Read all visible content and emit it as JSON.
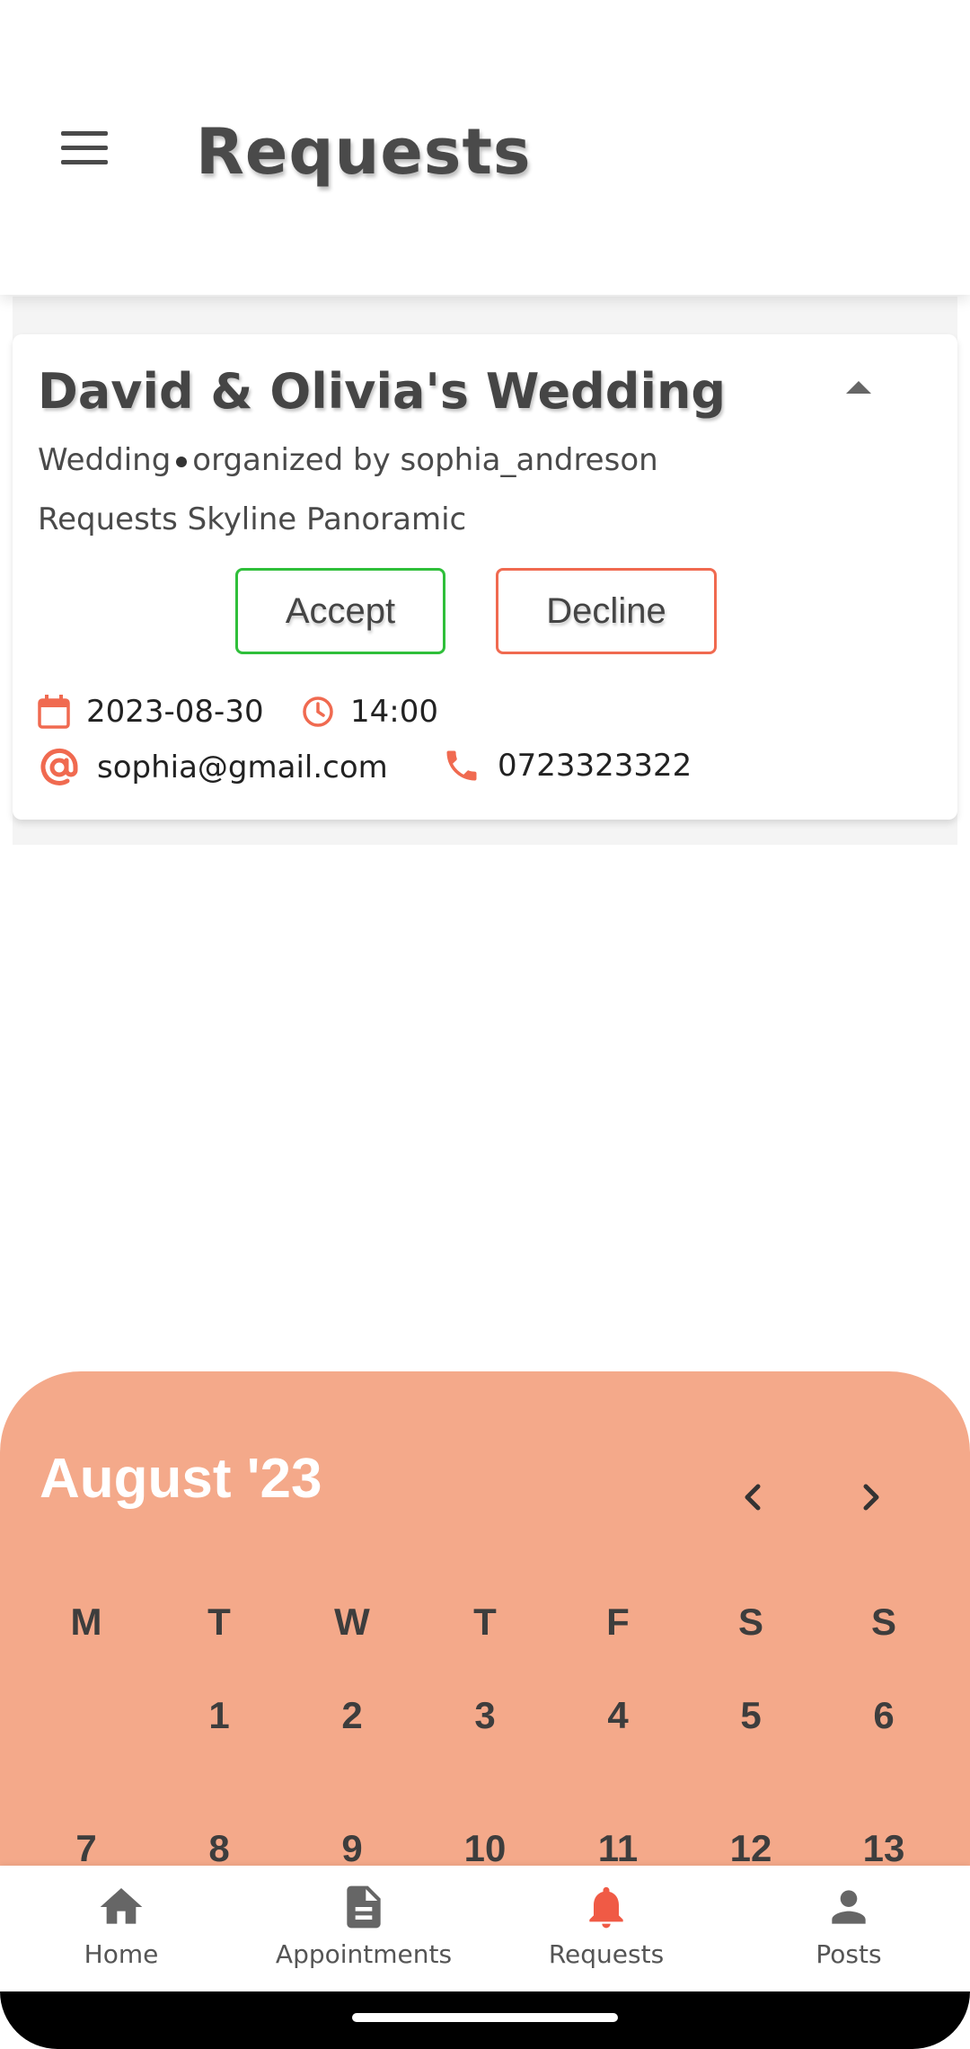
{
  "app_bar": {
    "title": "Requests",
    "menu_icon": "hamburger-menu-icon"
  },
  "request_card": {
    "title": "David & Olivia's Wedding",
    "event_type": "Wedding",
    "organizer_text": "organized by sophia_andreson",
    "request_text": "Requests Skyline Panoramic",
    "accept_label": "Accept",
    "decline_label": "Decline",
    "date": "2023-08-30",
    "time": "14:00",
    "email": "sophia@gmail.com",
    "phone": "0723323322",
    "accent_color": "#f06a50",
    "accept_color": "#2fbf3a"
  },
  "calendar": {
    "month_label": "August '23",
    "weekdays": [
      "M",
      "T",
      "W",
      "T",
      "F",
      "S",
      "S"
    ],
    "weeks": [
      [
        "",
        "1",
        "2",
        "3",
        "4",
        "5",
        "6"
      ],
      [
        "7",
        "8",
        "9",
        "10",
        "11",
        "12",
        "13"
      ]
    ],
    "background_color": "#f4a98a"
  },
  "bottom_nav": {
    "items": [
      {
        "label": "Home",
        "icon": "home-icon"
      },
      {
        "label": "Appointments",
        "icon": "document-icon"
      },
      {
        "label": "Requests",
        "icon": "bell-icon",
        "active": true
      },
      {
        "label": "Posts",
        "icon": "person-icon"
      }
    ],
    "active_color": "#f05a45"
  }
}
